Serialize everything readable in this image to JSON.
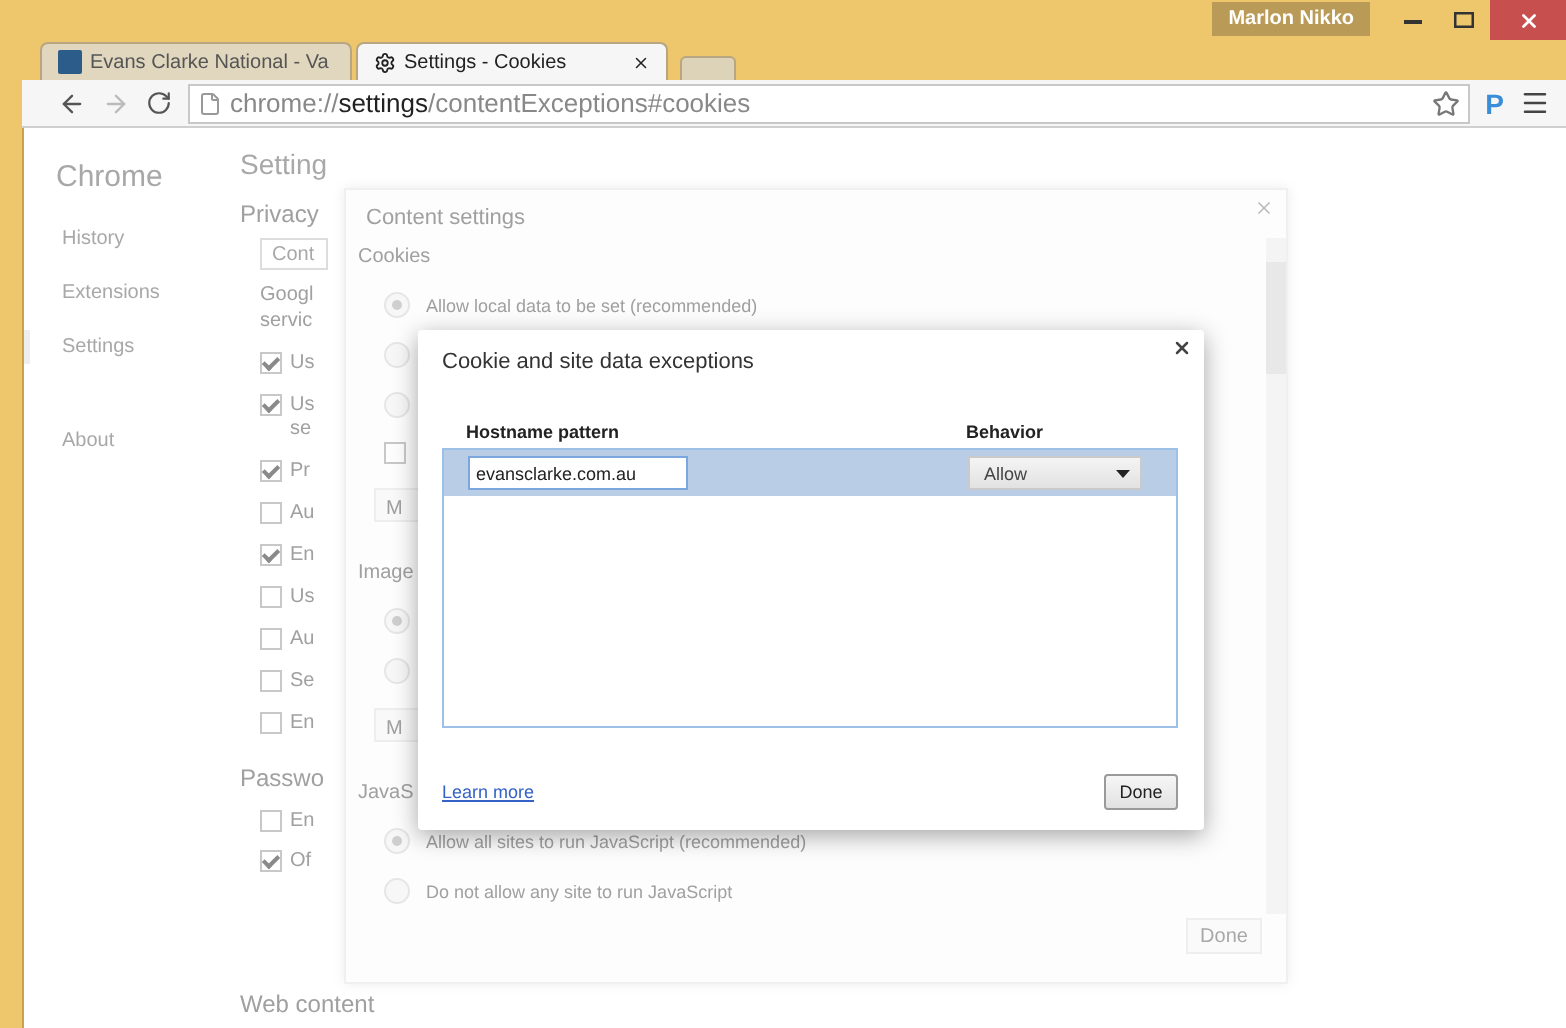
{
  "window": {
    "profile": "Marlon Nikko"
  },
  "tabs": [
    {
      "title": "Evans Clarke National - Va",
      "selected": false
    },
    {
      "title": "Settings - Cookies",
      "selected": true
    }
  ],
  "address": {
    "scheme": "chrome://",
    "host": "settings",
    "path": "/contentExceptions#cookies"
  },
  "extension": {
    "label": "P"
  },
  "sidebar": {
    "title": "Chrome",
    "items": [
      {
        "label": "History",
        "selected": false
      },
      {
        "label": "Extensions",
        "selected": false
      },
      {
        "label": "Settings",
        "selected": true
      },
      {
        "label": "About",
        "selected": false
      }
    ]
  },
  "settings_page": {
    "title": "Setting",
    "section": "Privacy",
    "button": "Cont",
    "description": [
      "Googl",
      "servic"
    ],
    "options": [
      {
        "label": "Us",
        "checked": true
      },
      {
        "label": "Us",
        "continuation": "se",
        "checked": true
      },
      {
        "label": "Pr",
        "checked": true
      },
      {
        "label": "Au",
        "checked": false
      },
      {
        "label": "En",
        "checked": true
      },
      {
        "label": "Us",
        "checked": false
      },
      {
        "label": "Au",
        "checked": false
      },
      {
        "label": "Se",
        "checked": false
      },
      {
        "label": "En",
        "checked": false
      }
    ],
    "passwords_heading": "Passwo",
    "password_options": [
      {
        "label": "En",
        "checked": false
      },
      {
        "label": "Of",
        "checked": true
      }
    ],
    "next_heading": "Web content"
  },
  "content_settings": {
    "title": "Content settings",
    "sections": [
      {
        "heading": "Cookies",
        "items": [
          {
            "kind": "radio",
            "label": "Allow local data to be set (recommended)",
            "selected": true
          },
          {
            "kind": "radio",
            "selected": false
          },
          {
            "kind": "radio",
            "selected": false
          },
          {
            "kind": "checkbox",
            "checked": false
          },
          {
            "kind": "button",
            "label": "M"
          }
        ]
      },
      {
        "heading": "Image",
        "items": [
          {
            "kind": "radio",
            "selected": true
          },
          {
            "kind": "radio",
            "selected": false
          },
          {
            "kind": "button",
            "label": "M"
          }
        ]
      },
      {
        "heading": "JavaS",
        "items": [
          {
            "kind": "radio",
            "label": "Allow all sites to run JavaScript (recommended)",
            "selected": true
          },
          {
            "kind": "radio",
            "label": "Do not allow any site to run JavaScript",
            "selected": false
          }
        ]
      }
    ],
    "done": {
      "label": "Done",
      "disabled": true
    }
  },
  "exceptions_dialog": {
    "title": "Cookie and site data exceptions",
    "columns": [
      "Hostname pattern",
      "Behavior"
    ],
    "rows": [
      {
        "hostname": "evansclarke.com.au",
        "behavior": "Allow",
        "selected": true
      }
    ],
    "learn_more": "Learn more",
    "done": "Done"
  }
}
